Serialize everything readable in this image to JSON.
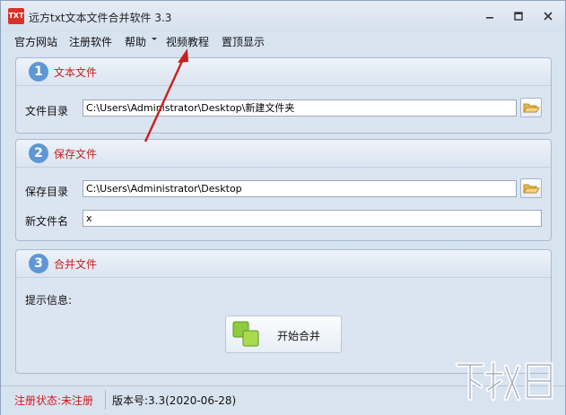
{
  "window": {
    "title": "远方txt文本文件合并软件 3.3",
    "app_icon_text": "TXT",
    "minimize_icon": "minimize-icon",
    "maximize_icon": "maximize-icon",
    "close_icon": "close-icon"
  },
  "menu": {
    "items": [
      "官方网站",
      "注册软件",
      "帮助",
      "视频教程",
      "置顶显示"
    ]
  },
  "panels": {
    "text_files": {
      "number": "1",
      "title": "文本文件",
      "dir_label": "文件目录",
      "dir_value": "C:\\Users\\Administrator\\Desktop\\新建文件夹"
    },
    "save_file": {
      "number": "2",
      "title": "保存文件",
      "dir_label": "保存目录",
      "dir_value": "C:\\Users\\Administrator\\Desktop",
      "name_label": "新文件名",
      "name_value": "x"
    },
    "merge": {
      "number": "3",
      "title": "合并文件",
      "hint_label": "提示信息:",
      "button_label": "开始合并"
    }
  },
  "status": {
    "registration": "注册状态:未注册",
    "version": "版本号:3.3(2020-06-28)"
  },
  "colors": {
    "accent_red": "#c62020",
    "badge_blue": "#5f97d4",
    "annotation_arrow": "#c8201c"
  },
  "watermark": {
    "text": "下载吧"
  }
}
